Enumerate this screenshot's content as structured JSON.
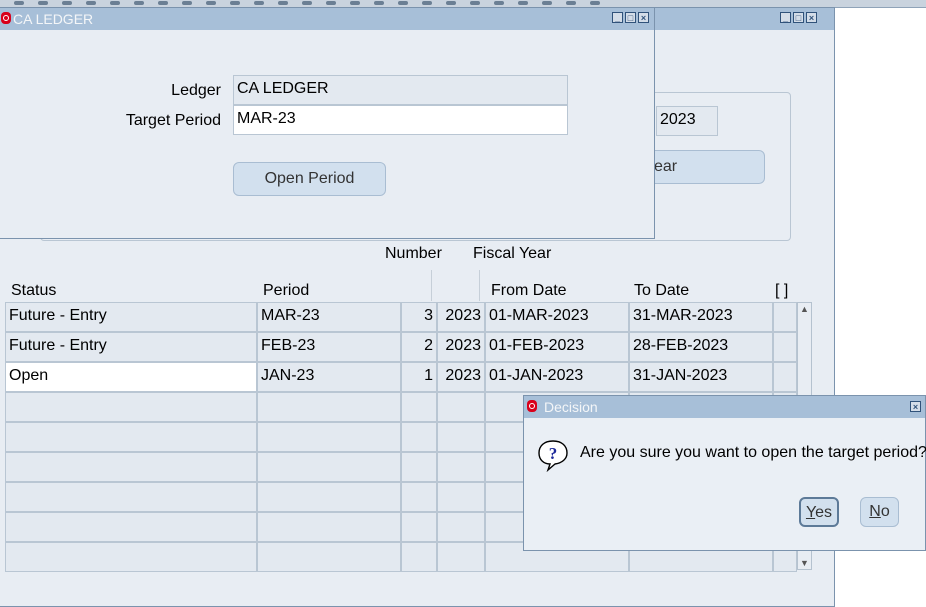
{
  "background_window": {
    "buttons": [
      "_",
      "□",
      "×"
    ],
    "year_value": "2023",
    "year_button_label": "ear"
  },
  "ledger_window": {
    "title": "CA LEDGER",
    "buttons": [
      "_",
      "□",
      "×"
    ],
    "ledger_label": "Ledger",
    "ledger_value": "CA LEDGER",
    "target_period_label": "Target Period",
    "target_period_value": "MAR-23",
    "open_period_button": "Open Period"
  },
  "table": {
    "group_headers": {
      "number": "Number",
      "fiscal_year": "Fiscal Year"
    },
    "headers": {
      "status": "Status",
      "period": "Period",
      "from_date": "From Date",
      "to_date": "To Date",
      "flag": "[ ]"
    },
    "rows": [
      {
        "status": "Future - Entry",
        "period": "MAR-23",
        "number": "3",
        "year": "2023",
        "from": "01-MAR-2023",
        "to": "31-MAR-2023"
      },
      {
        "status": "Future - Entry",
        "period": "FEB-23",
        "number": "2",
        "year": "2023",
        "from": "01-FEB-2023",
        "to": "28-FEB-2023"
      },
      {
        "status": "Open",
        "period": "JAN-23",
        "number": "1",
        "year": "2023",
        "from": "01-JAN-2023",
        "to": "31-JAN-2023"
      }
    ]
  },
  "decision_dialog": {
    "title": "Decision",
    "close": "×",
    "icon": "question-icon",
    "message": "Are you sure you want to open the target period?",
    "yes_rest": "es",
    "yes_mnemonic": "Y",
    "no_mnemonic": "N",
    "no_rest": "o"
  },
  "colors": {
    "titlebar": "#a7bfd8",
    "window_bg": "#e8edf3",
    "oracle_red": "#d9001b"
  }
}
